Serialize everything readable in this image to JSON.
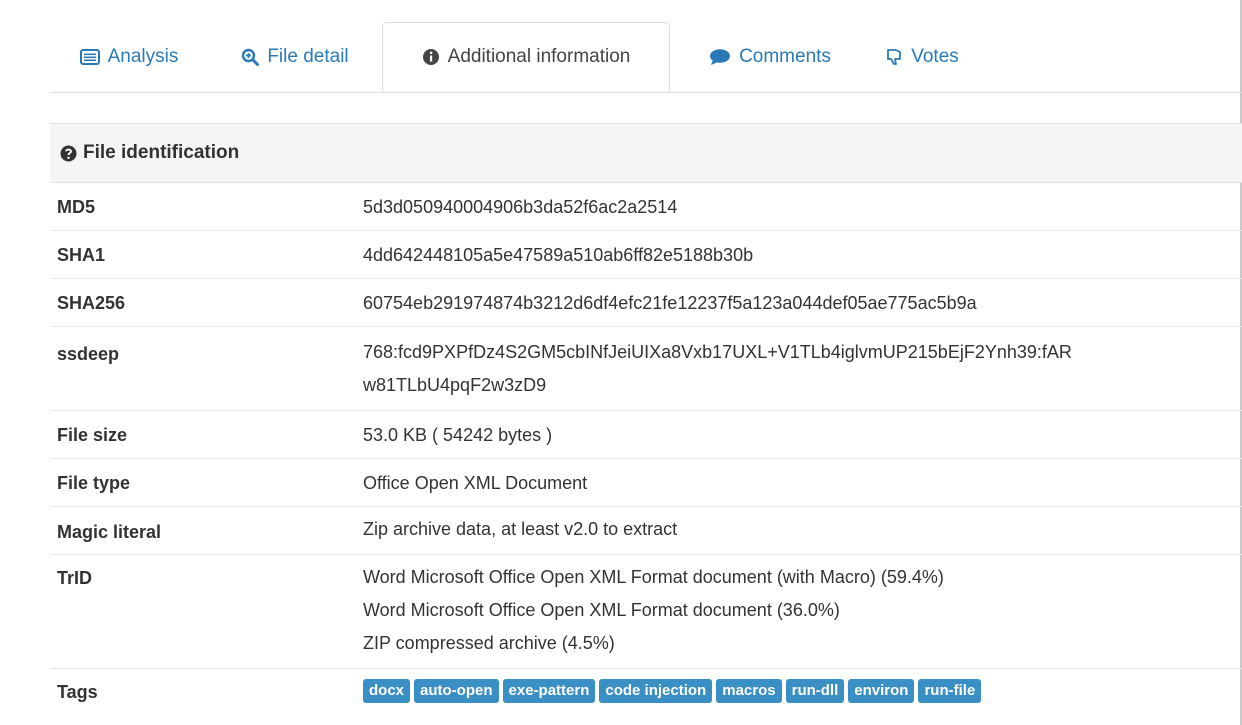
{
  "tabs": [
    {
      "label": "Analysis",
      "icon": "list-icon"
    },
    {
      "label": "File detail",
      "icon": "magnifier-icon"
    },
    {
      "label": "Additional information",
      "icon": "info-icon"
    },
    {
      "label": "Comments",
      "icon": "comment-icon"
    },
    {
      "label": "Votes",
      "icon": "thumbs-down-icon"
    }
  ],
  "section": {
    "title": "File identification",
    "icon": "question-icon"
  },
  "rows": {
    "md5": {
      "key": "MD5",
      "value": "5d3d050940004906b3da52f6ac2a2514"
    },
    "sha1": {
      "key": "SHA1",
      "value": "4dd642448105a5e47589a510ab6ff82e5188b30b"
    },
    "sha256": {
      "key": "SHA256",
      "value": "60754eb291974874b3212d6df4efc21fe12237f5a123a044def05ae775ac5b9a"
    },
    "ssdeep": {
      "key": "ssdeep",
      "line1": "768:fcd9PXPfDz4S2GM5cbINfJeiUIXa8Vxb17UXL+V1TLb4iglvmUP215bEjF2Ynh39:fAR",
      "line2": "w81TLbU4pqF2w3zD9"
    },
    "filesize": {
      "key": "File size",
      "value": "53.0 KB ( 54242 bytes )"
    },
    "filetype": {
      "key": "File type",
      "value": "Office Open XML Document"
    },
    "magic": {
      "key": "Magic literal",
      "value": "Zip archive data, at least v2.0 to extract"
    },
    "trid": {
      "key": "TrID",
      "lines": [
        "Word Microsoft Office Open XML Format document (with Macro) (59.4%)",
        "Word Microsoft Office Open XML Format document (36.0%)",
        "ZIP compressed archive (4.5%)"
      ]
    },
    "tags": {
      "key": "Tags",
      "items": [
        "docx",
        "auto-open",
        "exe-pattern",
        "code injection",
        "macros",
        "run-dll",
        "environ",
        "run-file"
      ]
    }
  },
  "colors": {
    "link": "#2a7ab8",
    "tag_bg": "#3a8fc4",
    "section_bg": "#f5f5f5"
  }
}
